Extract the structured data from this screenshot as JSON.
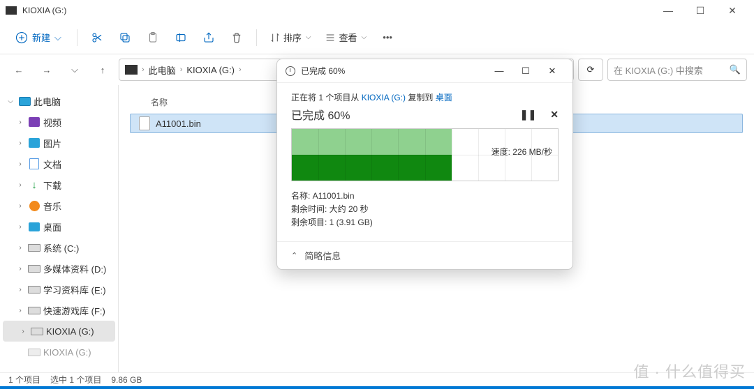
{
  "window": {
    "title": "KIOXIA (G:)"
  },
  "toolbar": {
    "new_label": "新建",
    "sort_label": "排序",
    "view_label": "查看"
  },
  "breadcrumb": {
    "items": [
      "此电脑",
      "KIOXIA (G:)"
    ]
  },
  "search": {
    "placeholder": "在 KIOXIA (G:) 中搜索"
  },
  "sidebar": {
    "root": "此电脑",
    "items": [
      {
        "label": "视频"
      },
      {
        "label": "图片"
      },
      {
        "label": "文档"
      },
      {
        "label": "下载"
      },
      {
        "label": "音乐"
      },
      {
        "label": "桌面"
      },
      {
        "label": "系统 (C:)"
      },
      {
        "label": "多媒体资料 (D:)"
      },
      {
        "label": "学习资料库 (E:)"
      },
      {
        "label": "快速游戏库 (F:)"
      },
      {
        "label": "KIOXIA (G:)"
      },
      {
        "label": "KIOXIA (G:)"
      }
    ]
  },
  "columns": {
    "name": "名称"
  },
  "files": [
    {
      "name": "A11001.bin"
    }
  ],
  "statusbar": {
    "count": "1 个项目",
    "selection": "选中 1 个项目",
    "size": "9.86 GB"
  },
  "dialog": {
    "title": "已完成 60%",
    "copy_prefix": "正在将 1 个项目从 ",
    "copy_src": "KIOXIA (G:)",
    "copy_mid": " 复制到 ",
    "copy_dst": "桌面",
    "progress_label": "已完成 60%",
    "progress_pct": 60,
    "speed_label": "速度: 226 MB/秒",
    "name_label": "名称: A11001.bin",
    "time_label": "剩余时间: 大约 20 秒",
    "items_label": "剩余项目: 1 (3.91 GB)",
    "footer": "简略信息"
  },
  "watermark": "值 · 什么值得买"
}
